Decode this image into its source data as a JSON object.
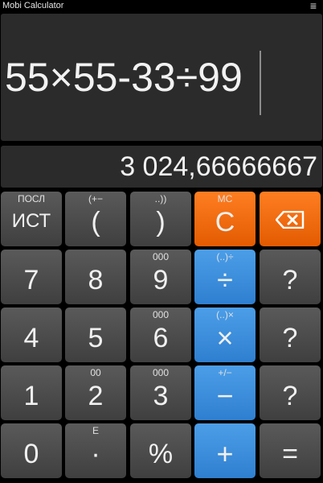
{
  "app": {
    "title": "Mobi Calculator",
    "menu_icon": "hamburger-icon"
  },
  "display": {
    "expression": "55×55-33÷99",
    "result": "3 024,66666667"
  },
  "keys": {
    "history": {
      "sub": "ПОСЛ",
      "label": "ИСТ"
    },
    "open_paren": {
      "sub": "(+−",
      "label": "("
    },
    "close_paren": {
      "sub": "..))",
      "label": ")"
    },
    "clear": {
      "sub": "MC",
      "label": "C"
    },
    "delete": {
      "icon": "backspace-icon"
    },
    "k7": {
      "label": "7"
    },
    "k8": {
      "label": "8"
    },
    "k9": {
      "sub": "000",
      "label": "9"
    },
    "divide": {
      "sub": "(..)÷",
      "label": "÷"
    },
    "m1": {
      "label": "?"
    },
    "k4": {
      "label": "4"
    },
    "k5": {
      "label": "5"
    },
    "k6": {
      "sub": "000",
      "label": "6"
    },
    "multiply": {
      "sub": "(..)×",
      "label": "×"
    },
    "m2": {
      "label": "?"
    },
    "k1": {
      "label": "1"
    },
    "k2": {
      "sub": "00",
      "label": "2"
    },
    "k3": {
      "sub": "000",
      "label": "3"
    },
    "minus": {
      "sub": "+/−",
      "label": "−"
    },
    "m3": {
      "label": "?"
    },
    "k0": {
      "label": "0"
    },
    "decimal": {
      "sub": "E",
      "label": "·"
    },
    "percent": {
      "label": "%"
    },
    "plus": {
      "label": "+"
    },
    "equals": {
      "label": "="
    }
  },
  "colors": {
    "orange": "#f26b10",
    "blue": "#3b8de0",
    "gray": "#4b4b4b"
  }
}
